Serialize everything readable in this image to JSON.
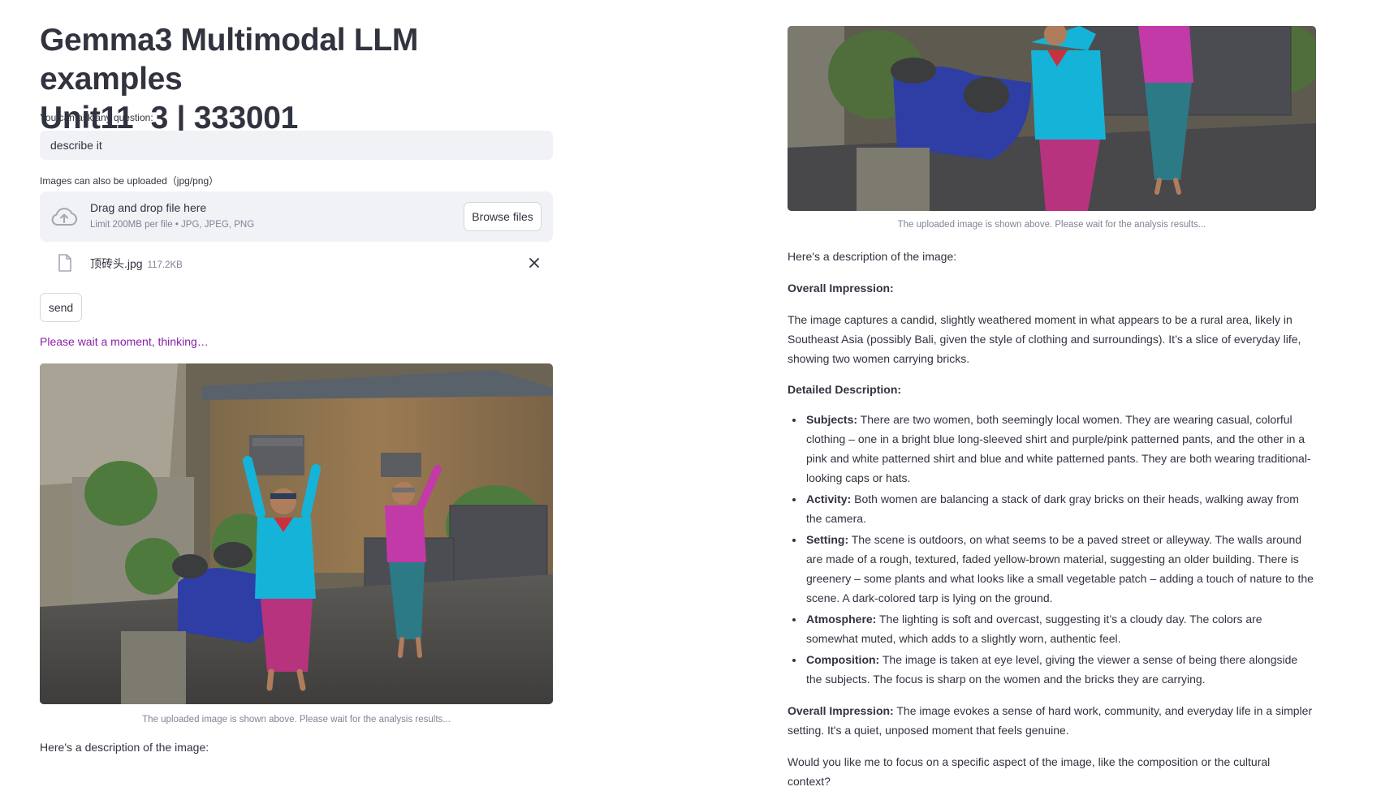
{
  "header": {
    "title_line1": "Gemma3 Multimodal LLM examples",
    "title_line2": "Unit11_3 | 333001"
  },
  "question": {
    "label": "You can ask any question:",
    "value": "describe it"
  },
  "uploader": {
    "label": "Images can also be uploaded（jpg/png）",
    "drop_title": "Drag and drop file here",
    "limit_text": "Limit 200MB per file • JPG, JPEG, PNG",
    "browse_label": "Browse files",
    "upload_icon": "cloud-upload-icon",
    "file": {
      "name": "顶砖头.jpg",
      "size": "117.2KB",
      "file_icon": "file-icon",
      "remove_icon": "close-icon"
    }
  },
  "send_label": "send",
  "status_text": "Please wait a moment, thinking…",
  "image_caption": "The uploaded image is shown above. Please wait for the analysis results...",
  "left_result_intro": "Here's a description of the image:",
  "result": {
    "intro": "Here's a description of the image:",
    "overall_heading": "Overall Impression:",
    "overall_text": "The image captures a candid, slightly weathered moment in what appears to be a rural area, likely in Southeast Asia (possibly Bali, given the style of clothing and surroundings). It’s a slice of everyday life, showing two women carrying bricks.",
    "detailed_heading": "Detailed Description:",
    "bullets": [
      {
        "term": "Subjects:",
        "text": "There are two women, both seemingly local women. They are wearing casual, colorful clothing – one in a bright blue long-sleeved shirt and purple/pink patterned pants, and the other in a pink and white patterned shirt and blue and white patterned pants. They are both wearing traditional-looking caps or hats."
      },
      {
        "term": "Activity:",
        "text": "Both women are balancing a stack of dark gray bricks on their heads, walking away from the camera."
      },
      {
        "term": "Setting:",
        "text": "The scene is outdoors, on what seems to be a paved street or alleyway. The walls around are made of a rough, textured, faded yellow-brown material, suggesting an older building. There is greenery – some plants and what looks like a small vegetable patch – adding a touch of nature to the scene. A dark-colored tarp is lying on the ground."
      },
      {
        "term": "Atmosphere:",
        "text": "The lighting is soft and overcast, suggesting it’s a cloudy day. The colors are somewhat muted, which adds to a slightly worn, authentic feel."
      },
      {
        "term": "Composition:",
        "text": "The image is taken at eye level, giving the viewer a sense of being there alongside the subjects. The focus is sharp on the women and the bricks they are carrying."
      }
    ],
    "closing_term": "Overall Impression:",
    "closing_text": "The image evokes a sense of hard work, community, and everyday life in a simpler setting. It's a quiet, unposed moment that feels genuine.",
    "followup": "Would you like me to focus on a specific aspect of the image, like the composition or the cultural context?"
  },
  "colors": {
    "text": "#31333f",
    "muted": "#808495",
    "input_bg": "#f0f2f6",
    "status": "#8a1fa8"
  }
}
